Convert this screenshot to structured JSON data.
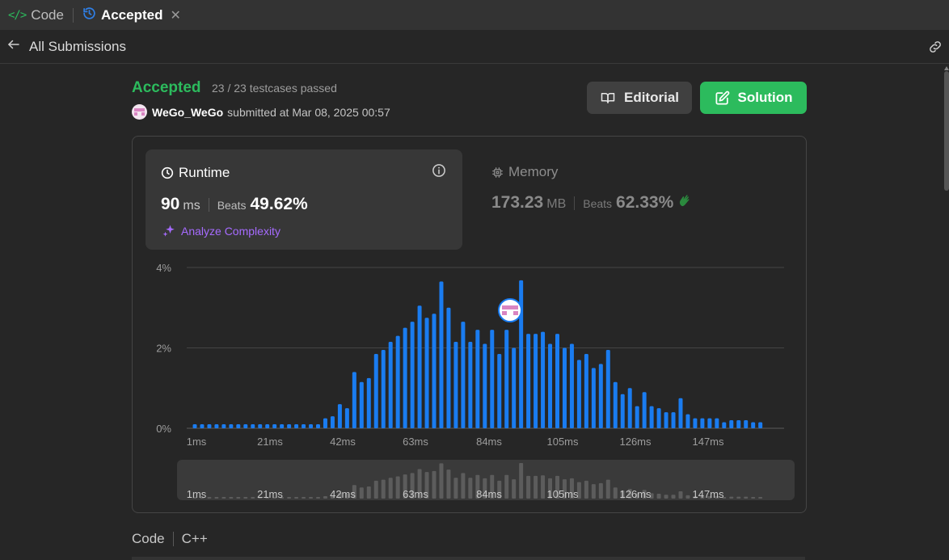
{
  "tabs": {
    "code_label": "Code",
    "accepted_label": "Accepted",
    "close_glyph": "✕"
  },
  "subheader": {
    "back_label": "All Submissions"
  },
  "submission": {
    "status": "Accepted",
    "testcases": "23 / 23 testcases passed",
    "author": "WeGo_WeGo",
    "submitted_text": "submitted at Mar 08, 2025 00:57"
  },
  "buttons": {
    "editorial": "Editorial",
    "solution": "Solution"
  },
  "runtime": {
    "title": "Runtime",
    "value": "90",
    "unit": "ms",
    "beats_label": "Beats",
    "beats_value": "49.62%",
    "analyze_label": "Analyze Complexity"
  },
  "memory": {
    "title": "Memory",
    "value": "173.23",
    "unit": "MB",
    "beats_label": "Beats",
    "beats_value": "62.33%"
  },
  "code_section": {
    "label": "Code",
    "language": "C++"
  },
  "colors": {
    "accent_green": "#2cbb5d",
    "bar_blue": "#1a7cf0",
    "analyze_purple": "#a66bff"
  },
  "chart_data": {
    "type": "bar",
    "x_ticks": [
      "1ms",
      "21ms",
      "42ms",
      "63ms",
      "84ms",
      "105ms",
      "126ms",
      "147ms"
    ],
    "y_ticks": [
      "4%",
      "2%",
      "0%"
    ],
    "ylim": [
      0,
      4
    ],
    "grid": true,
    "values": [
      0.1,
      0.1,
      0.1,
      0.1,
      0.1,
      0.1,
      0.1,
      0.1,
      0.1,
      0.1,
      0.1,
      0.1,
      0.1,
      0.1,
      0.1,
      0.1,
      0.1,
      0.1,
      0.25,
      0.3,
      0.6,
      0.5,
      1.4,
      1.15,
      1.25,
      1.85,
      1.95,
      2.15,
      2.3,
      2.5,
      2.65,
      3.05,
      2.75,
      2.85,
      3.65,
      3.0,
      2.15,
      2.65,
      2.15,
      2.45,
      2.1,
      2.45,
      1.85,
      2.45,
      2.0,
      3.68,
      2.35,
      2.35,
      2.4,
      2.1,
      2.35,
      2.0,
      2.1,
      1.7,
      1.85,
      1.5,
      1.6,
      1.95,
      1.15,
      0.85,
      1.0,
      0.55,
      0.9,
      0.55,
      0.5,
      0.4,
      0.4,
      0.75,
      0.35,
      0.25,
      0.25,
      0.25,
      0.25,
      0.15,
      0.2,
      0.2,
      0.2,
      0.15,
      0.15
    ],
    "highlight": {
      "x_label": "90ms",
      "marker": "avatar"
    }
  }
}
